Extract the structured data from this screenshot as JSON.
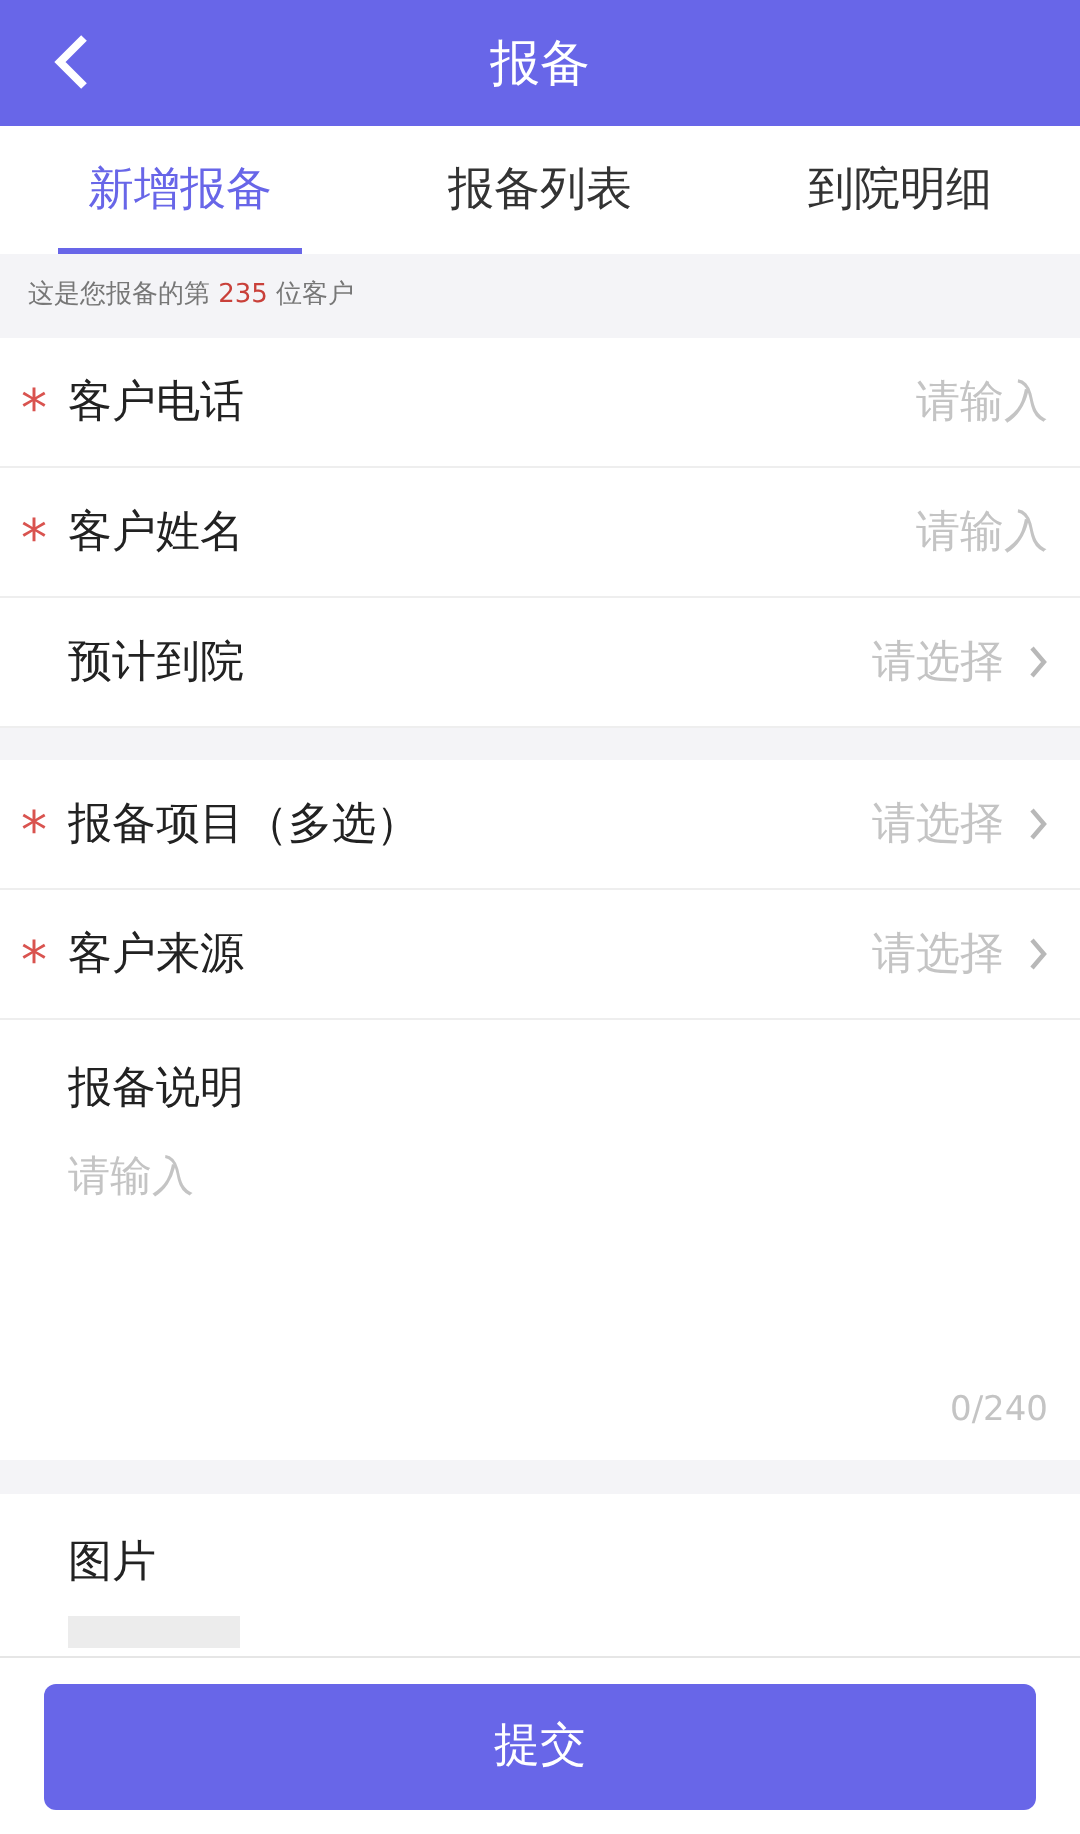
{
  "header": {
    "title": "报备"
  },
  "tabs": [
    {
      "label": "新增报备",
      "selected": true
    },
    {
      "label": "报备列表",
      "selected": false
    },
    {
      "label": "到院明细",
      "selected": false
    }
  ],
  "notice": {
    "prefix": "这是您报备的第",
    "count": "235",
    "suffix": "位客户"
  },
  "groups": [
    [
      {
        "label": "客户电话",
        "required": true,
        "kind": "input",
        "placeholder": "请输入"
      },
      {
        "label": "客户姓名",
        "required": true,
        "kind": "input",
        "placeholder": "请输入"
      },
      {
        "label": "预计到院",
        "required": false,
        "kind": "select",
        "placeholder": "请选择"
      }
    ],
    [
      {
        "label": "报备项目（多选）",
        "required": true,
        "kind": "select",
        "placeholder": "请选择"
      },
      {
        "label": "客户来源",
        "required": true,
        "kind": "select",
        "placeholder": "请选择"
      }
    ]
  ],
  "required_mark": "*",
  "remarks": {
    "label": "报备说明",
    "placeholder": "请输入",
    "counter": "0/240"
  },
  "images": {
    "label": "图片"
  },
  "submit": "提交"
}
